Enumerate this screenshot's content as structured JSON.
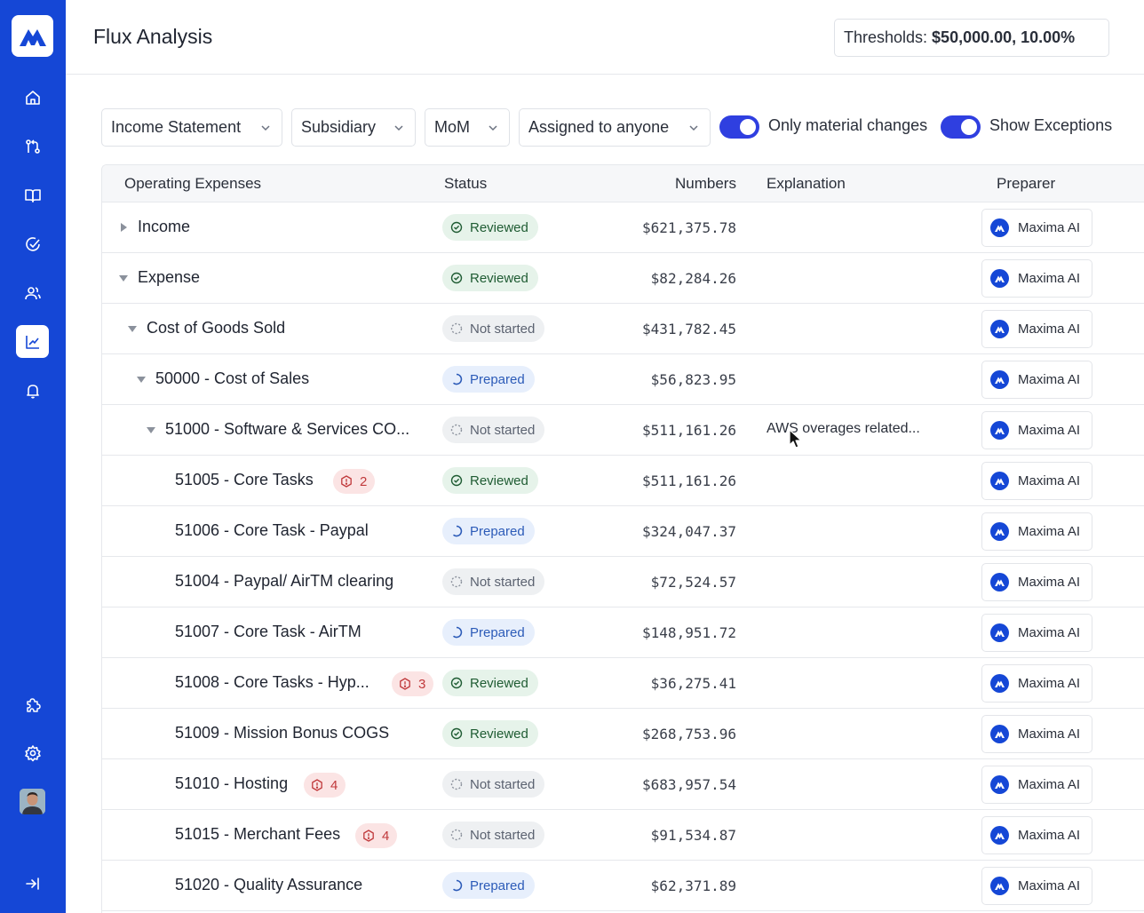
{
  "header": {
    "title": "Flux Analysis",
    "thresholds_label": "Thresholds:",
    "thresholds_value": "$50,000.00, 10.00%"
  },
  "sidebar": {
    "items": [
      {
        "icon": "home-icon"
      },
      {
        "icon": "git-compare-icon"
      },
      {
        "icon": "book-icon"
      },
      {
        "icon": "check-circle-icon"
      },
      {
        "icon": "users-icon"
      },
      {
        "icon": "chart-icon",
        "active": true
      },
      {
        "icon": "bell-icon"
      },
      {
        "icon": "puzzle-icon"
      },
      {
        "icon": "settings-icon"
      },
      {
        "icon": "collapse-sidebar-icon"
      }
    ]
  },
  "filters": {
    "statement": "Income Statement",
    "subsidiary": "Subsidiary",
    "period": "MoM",
    "assignee": "Assigned to anyone",
    "toggle_material": {
      "label": "Only material changes",
      "on": true
    },
    "toggle_exceptions": {
      "label": "Show Exceptions",
      "on": true
    }
  },
  "table": {
    "columns": [
      "Operating Expenses",
      "Status",
      "Numbers",
      "Explanation",
      "Preparer"
    ],
    "rows": [
      {
        "name": "Income",
        "status": "Reviewed",
        "number": "$621,375.78",
        "explanation": "",
        "preparer": "Maxima AI",
        "caret": "collapsed"
      },
      {
        "name": "Expense",
        "status": "Reviewed",
        "number": "$82,284.26",
        "explanation": "",
        "preparer": "Maxima AI",
        "caret": "expanded"
      },
      {
        "name": "Cost of Goods Sold",
        "status": "Not started",
        "number": "$431,782.45",
        "explanation": "",
        "preparer": "Maxima AI",
        "caret": "expanded"
      },
      {
        "name": "50000 - Cost of Sales",
        "status": "Prepared",
        "number": "$56,823.95",
        "explanation": "",
        "preparer": "Maxima AI",
        "caret": "expanded"
      },
      {
        "name": "51000 - Software & Services CO...",
        "status": "Not started",
        "number": "$511,161.26",
        "explanation": "AWS overages related...",
        "preparer": "Maxima AI",
        "caret": "expanded"
      },
      {
        "name": "51005 - Core Tasks",
        "exceptions": "2",
        "status": "Reviewed",
        "number": "$511,161.26",
        "explanation": "",
        "preparer": "Maxima AI"
      },
      {
        "name": "51006 - Core Task - Paypal",
        "status": "Prepared",
        "number": "$324,047.37",
        "explanation": "",
        "preparer": "Maxima AI"
      },
      {
        "name": "51004 - Paypal/ AirTM clearing",
        "status": "Not started",
        "number": "$72,524.57",
        "explanation": "",
        "preparer": "Maxima AI"
      },
      {
        "name": "51007 - Core Task - AirTM",
        "status": "Prepared",
        "number": "$148,951.72",
        "explanation": "",
        "preparer": "Maxima AI"
      },
      {
        "name": "51008 - Core Tasks - Hyp...",
        "exceptions": "3",
        "status": "Reviewed",
        "number": "$36,275.41",
        "explanation": "",
        "preparer": "Maxima AI"
      },
      {
        "name": "51009 - Mission Bonus COGS",
        "status": "Reviewed",
        "number": "$268,753.96",
        "explanation": "",
        "preparer": "Maxima AI"
      },
      {
        "name": "51010 - Hosting",
        "exceptions": "4",
        "status": "Not started",
        "number": "$683,957.54",
        "explanation": "",
        "preparer": "Maxima AI"
      },
      {
        "name": "51015 - Merchant Fees",
        "exceptions": "4",
        "status": "Not started",
        "number": "$91,534.87",
        "explanation": "",
        "preparer": "Maxima AI"
      },
      {
        "name": "51020 - Quality Assurance",
        "status": "Prepared",
        "number": "$62,371.89",
        "explanation": "",
        "preparer": "Maxima AI"
      }
    ]
  },
  "colors": {
    "brand": "#1547d6",
    "toggle": "#2f3fe0",
    "reviewed": "#1f5c33",
    "prepared": "#2c5bb8",
    "exception": "#c0393b"
  }
}
